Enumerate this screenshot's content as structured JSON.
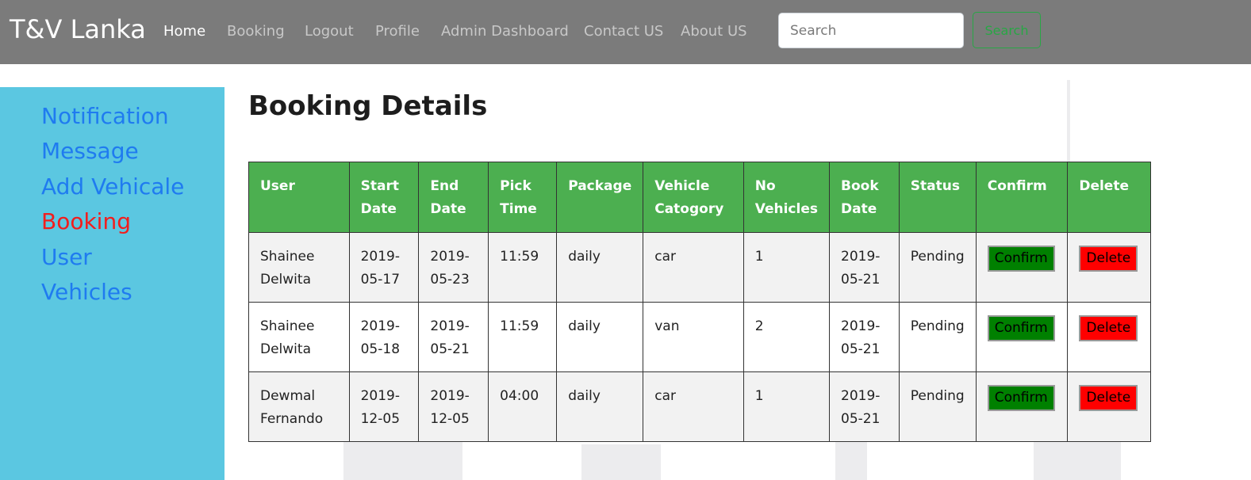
{
  "navbar": {
    "brand": "T&V Lanka",
    "items": [
      {
        "label": "Home",
        "active": true
      },
      {
        "label": "Booking",
        "active": false
      },
      {
        "label": "Logout",
        "active": false
      },
      {
        "label": "Profile",
        "active": false
      },
      {
        "label": "Admin Dashboard",
        "active": false
      },
      {
        "label": "Contact US",
        "active": false
      },
      {
        "label": "About US",
        "active": false
      }
    ],
    "search_placeholder": "Search",
    "search_button": "Search"
  },
  "sidebar": {
    "items": [
      {
        "label": "Notification",
        "active": false
      },
      {
        "label": "Message",
        "active": false
      },
      {
        "label": "Add Vehicale",
        "active": false
      },
      {
        "label": "Booking",
        "active": true
      },
      {
        "label": "User",
        "active": false
      },
      {
        "label": "Vehicles",
        "active": false
      }
    ]
  },
  "main": {
    "title": "Booking Details",
    "table": {
      "headers": [
        [
          "User"
        ],
        [
          "Start",
          "Date"
        ],
        [
          "End",
          "Date"
        ],
        [
          "Pick",
          "Time"
        ],
        [
          "Package"
        ],
        [
          "Vehicle",
          "Catogory"
        ],
        [
          "No",
          "Vehicles"
        ],
        [
          "Book",
          "Date"
        ],
        [
          "Status"
        ],
        [
          "Confirm"
        ],
        [
          "Delete"
        ]
      ],
      "rows": [
        {
          "user": [
            "Shainee",
            "Delwita"
          ],
          "start_date": [
            "2019-",
            "05-17"
          ],
          "end_date": [
            "2019-",
            "05-23"
          ],
          "pick_time": "11:59",
          "package": "daily",
          "vehicle_category": "car",
          "no_vehicles": "1",
          "book_date": [
            "2019-",
            "05-21"
          ],
          "status": "Pending",
          "confirm_label": "Confirm",
          "delete_label": "Delete"
        },
        {
          "user": [
            "Shainee",
            "Delwita"
          ],
          "start_date": [
            "2019-",
            "05-18"
          ],
          "end_date": [
            "2019-",
            "05-21"
          ],
          "pick_time": "11:59",
          "package": "daily",
          "vehicle_category": "van",
          "no_vehicles": "2",
          "book_date": [
            "2019-",
            "05-21"
          ],
          "status": "Pending",
          "confirm_label": "Confirm",
          "delete_label": "Delete"
        },
        {
          "user": [
            "Dewmal",
            "Fernando"
          ],
          "start_date": [
            "2019-",
            "12-05"
          ],
          "end_date": [
            "2019-",
            "12-05"
          ],
          "pick_time": "04:00",
          "package": "daily",
          "vehicle_category": "car",
          "no_vehicles": "1",
          "book_date": [
            "2019-",
            "05-21"
          ],
          "status": "Pending",
          "confirm_label": "Confirm",
          "delete_label": "Delete"
        }
      ]
    }
  },
  "colors": {
    "navbar_bg": "#7b7b7b",
    "sidebar_bg": "#5bc7e1",
    "sidebar_link": "#1f7bf0",
    "sidebar_active": "#f21d1d",
    "table_header_bg": "#4caf50",
    "confirm_bg": "#008000",
    "delete_bg": "#ff0000",
    "search_button": "#28a745"
  }
}
